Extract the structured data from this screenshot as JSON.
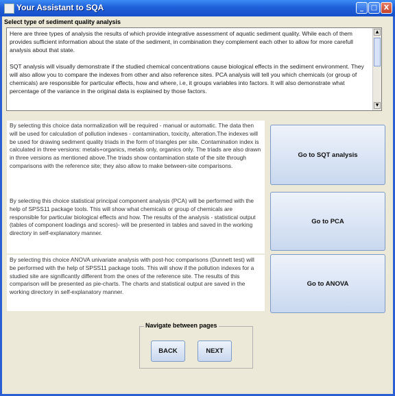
{
  "window": {
    "title": "Your Assistant to SQA",
    "controls": {
      "minimize": "_",
      "maximize": "□",
      "close": "X"
    }
  },
  "section_label": "Select type of sediment quality analysis",
  "info": {
    "paragraphs": [
      "Here are three types of analysis the results of which provide integrative assessment of aquatic sediment quality. While each of them provides sufficient information about the state of the sediment, in combination they complement each other to allow for more carefull analysis about that state.",
      "SQT analysis will visually demonstrate if the studied chemical concentrations cause biological effects in the sediment environment. They will also allow you to compare the indexes from other and also reference sites. PCA analysis will tell you which chemicals (or group of chemicals) are responsible for particular effects, how and where, i.e, it groups variables into factors. It will also demonstrate what percentage of the variance in the original data is explained by those factors."
    ],
    "scroll_up": "▲",
    "scroll_down": "▼"
  },
  "options": [
    {
      "description": "By selecting this choice data normalization will be required - manual or automatic. The data then will be used for calculation of pollution indexes - contamination, toxicity, alteration.The indexes will be used for drawing sediment quality triads in the form of triangles per site. Contamination index is calculated in three versions: metals+organics, metals only, organics only. The triads are also drawn in three versions as mentioned above.The triads show contamination state of the site through comparisons with the reference site; they also allow to make between-site comparisons.",
      "button": "Go to SQT analysis"
    },
    {
      "description": "By selecting this choice statistical principal component analysis (PCA) will be performed with the help of SPSS11 package tools. This will show what chemicals or group of chemicals are responsible for particular biological effects and how. The results of the analysis - statistical output (tables of component loadings and scores)- will be presented in tables and saved in the working directory in self-explanatory manner.",
      "button": "Go to PCA"
    },
    {
      "description": "By selecting this choice ANOVA univariate analysis with post-hoc comparisons (Dunnett test) will be performed with the help of SPSS11 package tools. This will show if the pollution indexes for a studied site are significantly different from the ones of the reference site. The results of this comparison will be presented as pie-charts. The charts and statistical output are saved in the working directory in self-explanatory manner.",
      "button": "Go to ANOVA"
    }
  ],
  "navigation": {
    "legend": "Navigate between pages",
    "back": "BACK",
    "next": "NEXT"
  }
}
